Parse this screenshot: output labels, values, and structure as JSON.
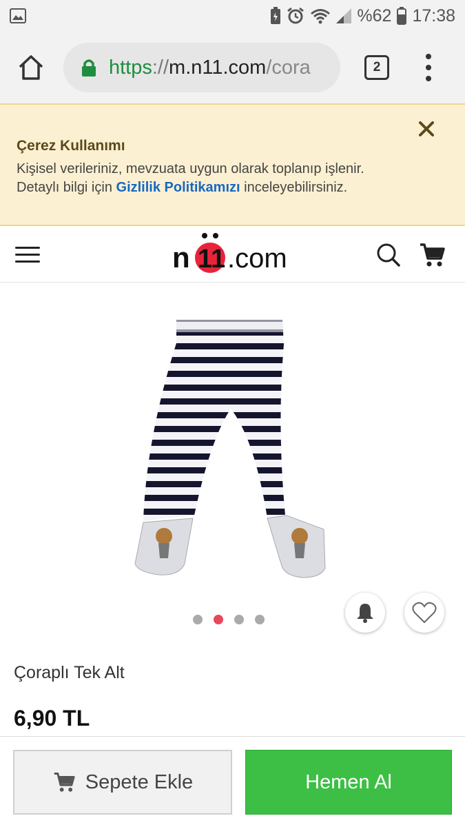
{
  "status_bar": {
    "battery": "%62",
    "time": "17:38",
    "icons": [
      "image-icon",
      "battery-saver-icon",
      "alarm-icon",
      "wifi-icon",
      "signal-icon",
      "battery-icon"
    ]
  },
  "browser": {
    "url_scheme": "https",
    "url_sep": "://",
    "url_host": "m.n11.com",
    "url_path": "/cora",
    "tab_count": "2"
  },
  "cookie_banner": {
    "title": "Çerez Kullanımı",
    "line1": "Kişisel verileriniz, mevzuata uygun olarak toplanıp işlenir.",
    "line2_before": "Detaylı bilgi için ",
    "link": "Gizlilik Politikamızı",
    "line2_after": " inceleyebilirsiniz."
  },
  "site": {
    "logo_n": "n",
    "logo_11": "11",
    "logo_com": ".com"
  },
  "product": {
    "name": "Çoraplı Tek Alt",
    "price": "6,90 TL",
    "image_dots": 4,
    "active_dot": 2
  },
  "actions": {
    "add_to_cart": "Sepete Ekle",
    "buy_now": "Hemen Al"
  },
  "colors": {
    "accent_green": "#3dbf45",
    "link_blue": "#1668c2",
    "active_dot": "#e8485a",
    "banner_bg": "#fcf0d2"
  }
}
